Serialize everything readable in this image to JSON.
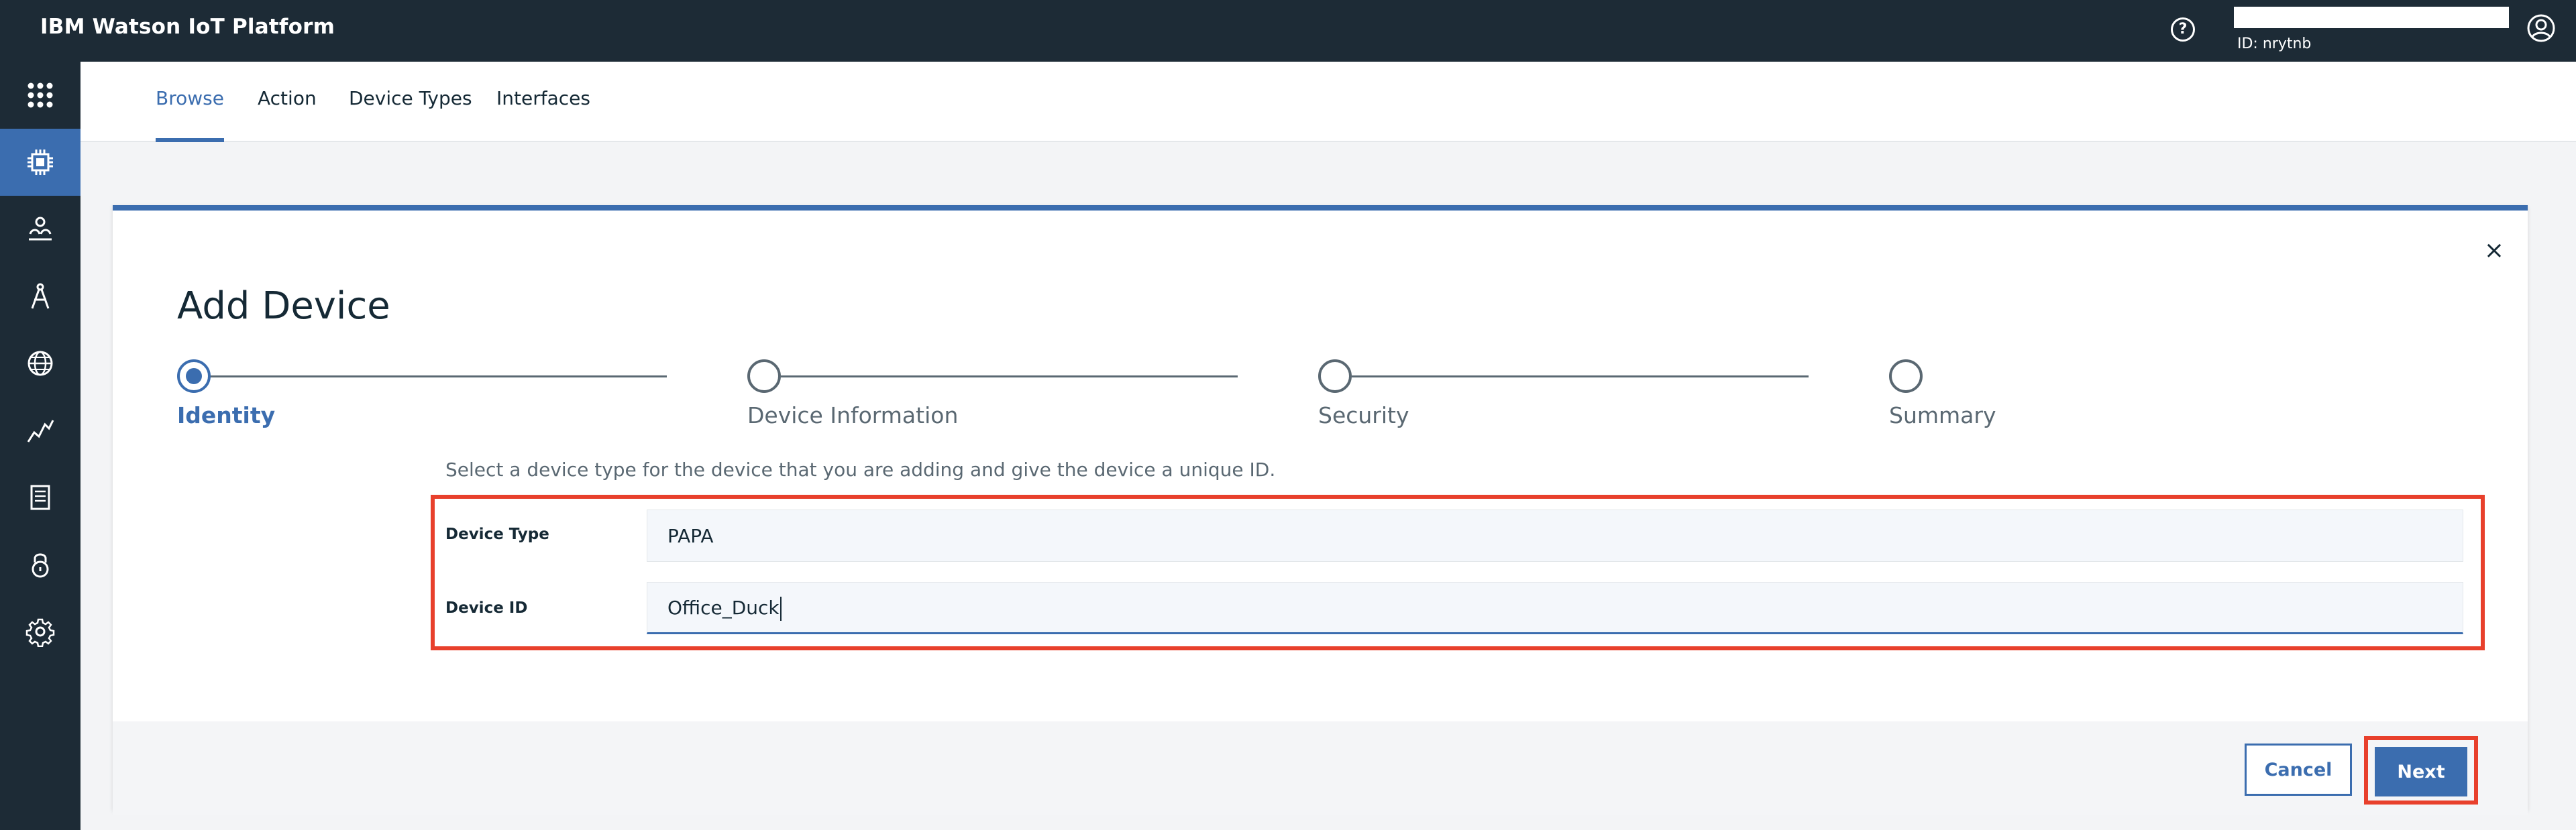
{
  "header": {
    "title": "IBM Watson IoT Platform",
    "account_id": "ID: nrytnb"
  },
  "sidebar": {
    "items": [
      {
        "icon": "apps-grid-icon",
        "active": false
      },
      {
        "icon": "devices-chip-icon",
        "active": true
      },
      {
        "icon": "members-icon",
        "active": false
      },
      {
        "icon": "apps-compass-icon",
        "active": false
      },
      {
        "icon": "analytics-globe-icon",
        "active": false
      },
      {
        "icon": "usage-chart-icon",
        "active": false
      },
      {
        "icon": "rules-document-icon",
        "active": false
      },
      {
        "icon": "security-lock-icon",
        "active": false
      },
      {
        "icon": "settings-gear-icon",
        "active": false
      }
    ]
  },
  "tabs": [
    {
      "label": "Browse",
      "active": true
    },
    {
      "label": "Action",
      "active": false
    },
    {
      "label": "Device Types",
      "active": false
    },
    {
      "label": "Interfaces",
      "active": false
    }
  ],
  "dialog": {
    "title": "Add Device",
    "close_symbol": "×",
    "steps": [
      {
        "label": "Identity",
        "active": true
      },
      {
        "label": "Device Information",
        "active": false
      },
      {
        "label": "Security",
        "active": false
      },
      {
        "label": "Summary",
        "active": false
      }
    ],
    "instructions": "Select a device type for the device that you are adding and give the device a unique ID.",
    "fields": {
      "device_type": {
        "label": "Device Type",
        "value": "PAPA"
      },
      "device_id": {
        "label": "Device ID",
        "value": "Office_Duck"
      }
    },
    "buttons": {
      "cancel": "Cancel",
      "next": "Next"
    }
  },
  "colors": {
    "accent": "#3b6daf",
    "nav_background": "#1d2b36",
    "highlight": "#e8402c"
  }
}
